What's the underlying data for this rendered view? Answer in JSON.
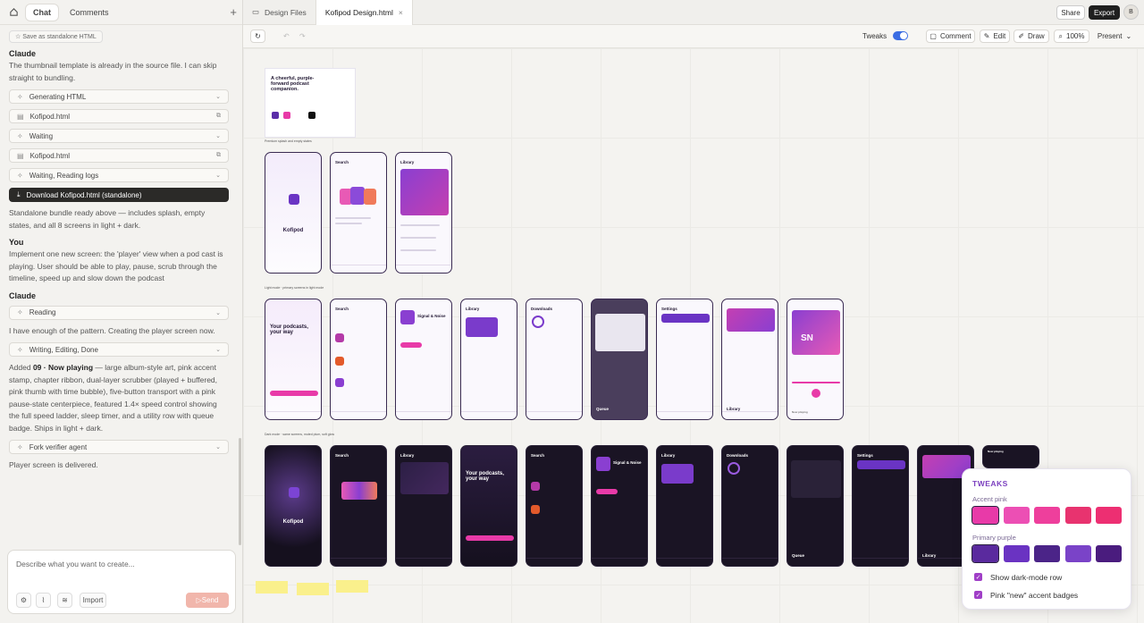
{
  "left_tabs": {
    "chat": "Chat",
    "comments": "Comments"
  },
  "chat": {
    "save_pill": "Save as standalone HTML",
    "speaker1": "Claude",
    "msg1": "The thumbnail template is already in the source file. I can skip straight to bundling.",
    "steps1": [
      "Generating HTML",
      "Kofipod.html",
      "Waiting",
      "Kofipod.html",
      "Waiting, Reading logs"
    ],
    "download_label": "Download Kofipod.html (standalone)",
    "msg2": "Standalone bundle ready above — includes splash, empty states, and all 8 screens in light + dark.",
    "speaker2": "You",
    "msg3": "Implement one new screen: the 'player' view when a pod cast is playing. User should be able to play, pause, scrub through the timeline, speed up and slow down the podcast",
    "speaker3": "Claude",
    "step_reading": "Reading",
    "msg4": "I have enough of the pattern. Creating the player screen now.",
    "step_writing": "Writing, Editing, Done",
    "msg5_prefix": "Added ",
    "msg5_bold": "09 · Now playing",
    "msg5_rest": " — large album-style art, pink accent stamp, chapter ribbon, dual-layer scrubber (played + buffered, pink thumb with time bubble), five-button transport with a pink pause-state centerpiece, featured 1.4× speed control showing the full speed ladder, sleep timer, and a utility row with queue badge. Ships in light + dark.",
    "step_fork": "Fork verifier agent",
    "msg6": "Player screen is delivered."
  },
  "composer": {
    "placeholder": "Describe what you want to create...",
    "import": "Import",
    "send": "Send"
  },
  "file_tabs": [
    "Design Files",
    "Kofipod Design.html"
  ],
  "top_actions": {
    "share": "Share",
    "export": "Export",
    "avatar": "B"
  },
  "toolbar": {
    "tweaks": "Tweaks",
    "comment": "Comment",
    "edit": "Edit",
    "draw": "Draw",
    "zoom": "100%",
    "present": "Present"
  },
  "canvas": {
    "hero_title": "A cheerful, purple-forward podcast companion.",
    "app_name": "Kofipod",
    "row1_label": "Premium splash and empty states",
    "row2_label": "Light mode · primary screens in light mode",
    "row3_label": "Dark mode · same screens, muted plum, soft glow",
    "splash_screen_label": "SN",
    "screens_light": [
      "Search",
      "Library",
      "Your podcasts, your way",
      "Search",
      "Signal & Noise",
      "Library",
      "Downloads",
      "Queue",
      "Settings",
      "Library",
      "Now playing"
    ],
    "screens_dark": [
      "Kofipod",
      "Search",
      "Library",
      "Your podcasts, your way",
      "Search",
      "Signal & Noise",
      "Library",
      "Downloads",
      "Queue",
      "Settings",
      "Library",
      "Now playing"
    ]
  },
  "tweaks": {
    "title": "TWEAKS",
    "accent_label": "Accent pink",
    "accent_colors": [
      "#e83aa8",
      "#ec4fb4",
      "#ee3f9c",
      "#e8336f",
      "#ed2f72"
    ],
    "primary_label": "Primary purple",
    "primary_colors": [
      "#5a2a9e",
      "#6a33c2",
      "#4b2488",
      "#7a43c8",
      "#4a1c7e"
    ],
    "opt1": "Show dark-mode row",
    "opt2": "Pink \"new\" accent badges"
  }
}
